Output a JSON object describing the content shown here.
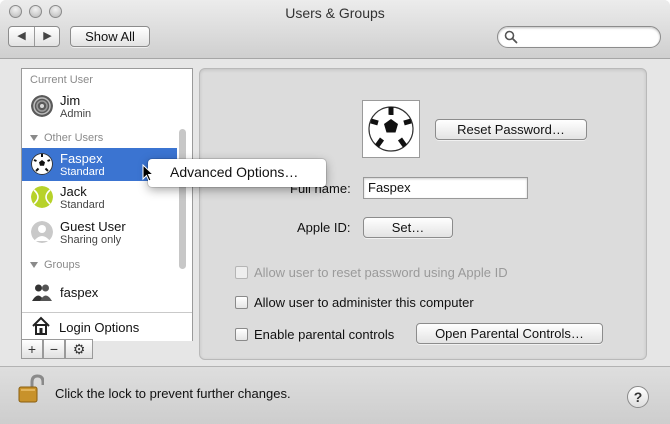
{
  "window": {
    "title": "Users & Groups"
  },
  "toolbar": {
    "show_all_label": "Show All",
    "back_glyph": "◀",
    "forward_glyph": "▶",
    "search_placeholder": ""
  },
  "sidebar": {
    "current_user_header": "Current User",
    "current_user": {
      "name": "Jim",
      "role": "Admin"
    },
    "other_users_header": "Other Users",
    "other_users": [
      {
        "name": "Faspex",
        "role": "Standard",
        "selected": true
      },
      {
        "name": "Jack",
        "role": "Standard",
        "selected": false
      },
      {
        "name": "Guest User",
        "role": "Sharing only",
        "selected": false
      }
    ],
    "groups_header": "Groups",
    "groups": [
      {
        "name": "faspex"
      }
    ],
    "login_options_label": "Login Options",
    "add_glyph": "+",
    "remove_glyph": "−",
    "action_glyph": "⚙"
  },
  "context_menu": {
    "item": "Advanced Options…"
  },
  "panel": {
    "reset_password_label": "Reset Password…",
    "full_name_label": "Full name:",
    "full_name_value": "Faspex",
    "apple_id_label": "Apple ID:",
    "set_button_label": "Set…",
    "allow_reset_label": "Allow user to reset password using Apple ID",
    "allow_admin_label": "Allow user to administer this computer",
    "parental_label": "Enable parental controls",
    "open_parental_label": "Open Parental Controls…"
  },
  "footer": {
    "lock_text": "Click the lock to prevent further changes.",
    "help_glyph": "?"
  },
  "colors": {
    "selection": "#3b74d1",
    "window_bg": "#e6e6e6",
    "lock_gold": "#c8922b"
  }
}
